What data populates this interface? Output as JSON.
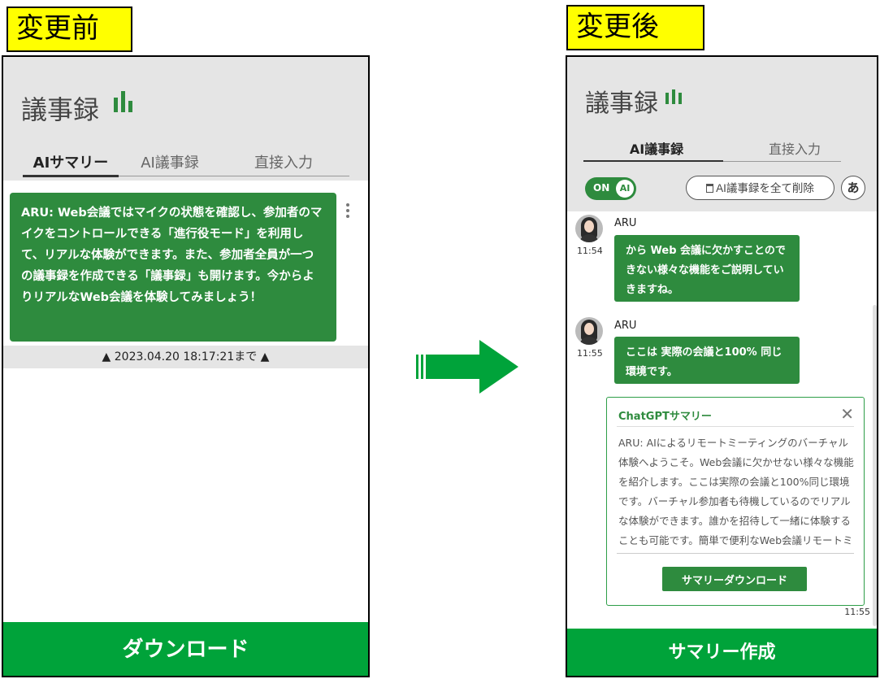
{
  "labels": {
    "before": "変更前",
    "after": "変更後"
  },
  "before": {
    "app_title": "議事録",
    "tabs": [
      {
        "label": "AIサマリー",
        "active": true
      },
      {
        "label": "AI議事録",
        "active": false
      },
      {
        "label": "直接入力",
        "active": false
      }
    ],
    "summary_text": "ARU: Web会議ではマイクの状態を確認し、参加者のマイクをコントロールできる「進行役モード」を利用して、リアルな体験ができます。また、参加者全員が一つの議事録を作成できる「議事録」も開けます。今からよりリアルなWeb会議を体験してみましょう！",
    "timestamp": "▲ 2023.04.20 18:17:21まで ▲",
    "download_label": "ダウンロード"
  },
  "after": {
    "app_title": "議事録",
    "tabs": [
      {
        "label": "AI議事録",
        "active": true
      },
      {
        "label": "直接入力",
        "active": false
      }
    ],
    "toggle": {
      "state": "ON",
      "knob": "AI"
    },
    "delete_all_label": "AI議事録を全て削除",
    "font_button": "あ",
    "messages": [
      {
        "speaker": "ARU",
        "time": "11:54",
        "text": "から Web 会議に欠かすことのできない様々な機能をご説明していきますね。"
      },
      {
        "speaker": "ARU",
        "time": "11:55",
        "text": "ここは 実際の会議と100% 同じ環境です。"
      }
    ],
    "summary_popup": {
      "title": "ChatGPTサマリー",
      "body": "ARU: AIによるリモートミーティングのバーチャル体験へようこそ。Web会議に欠かせない様々な機能を紹介します。ここは実際の会議と100%同じ環境です。バーチャル参加者も待機しているのでリアルな体験ができます。誰かを招待して一緒に体験することも可能です。簡単で便利なWeb会議リモートミーティングをご",
      "download_label": "サマリーダウンロード",
      "time": "11:55"
    },
    "create_summary_label": "サマリー作成"
  },
  "colors": {
    "accent_green": "#2e8b3e",
    "button_green": "#00a33a",
    "label_yellow": "#ffff00"
  }
}
